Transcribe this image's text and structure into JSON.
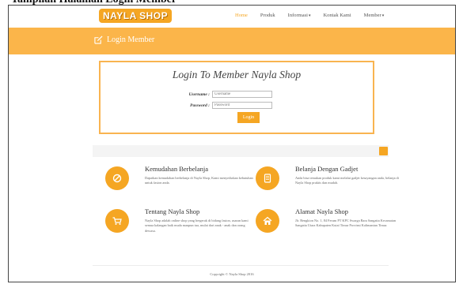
{
  "doc_header": {
    "text": "Tampilan Halaman Login Member"
  },
  "navbar": {
    "logo": "NAYLA SHOP",
    "items": [
      {
        "label": "Home",
        "active": true,
        "dropdown": false
      },
      {
        "label": "Produk",
        "active": false,
        "dropdown": false
      },
      {
        "label": "Informasi",
        "active": false,
        "dropdown": true
      },
      {
        "label": "Kontak Kami",
        "active": false,
        "dropdown": false
      },
      {
        "label": "Member",
        "active": false,
        "dropdown": true
      }
    ]
  },
  "banner": {
    "title": "Login Member",
    "icon": "edit-icon"
  },
  "login": {
    "heading": "Login To Member Nayla Shop",
    "username_label": "Username :",
    "username_placeholder": "Username",
    "password_label": "Password :",
    "password_placeholder": "Password",
    "button_label": "Login"
  },
  "features": [
    {
      "title": "Kemudahan Berbelanja",
      "desc": "Dapatkan kemudahan berbelanja di Nayla Shop, Kami menyediakan kebutuhan untuk fasion anda.",
      "icon": "ban-icon"
    },
    {
      "title": "Belanja Dengan Gadjet",
      "desc": "Anda bisa temukan produk kami melalui gadjet kesayangan anda, belanja di Nayla Shop praktis dan mudah.",
      "icon": "tablet-icon"
    },
    {
      "title": "Tentang Nayla Shop",
      "desc": "Nayla Shop adalah online shop yang bergerak di bidang fasion, usaran kami semua kalangan baik muda maupun tua, mulai dari anak - anak dan orang dewasa.",
      "icon": "cart-icon"
    },
    {
      "title": "Alamat Nayla Shop",
      "desc": "Jlr. Bengkion No. 1, 84 Ferum PT KPC Swarga Bara Sangatta Kecamatan Sangatta Utara Kabupaten Kutai Timur Provinsi Kalimantan Timur.",
      "icon": "home-icon"
    }
  ],
  "footer": {
    "copyright": "Copyright © Nayla Shop 2016"
  },
  "colors": {
    "accent": "#f5a623",
    "banner": "#fbb54a"
  }
}
